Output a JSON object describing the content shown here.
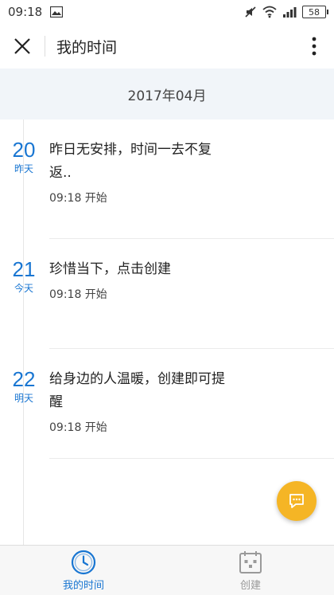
{
  "status_bar": {
    "time": "09:18",
    "battery": "58"
  },
  "title_bar": {
    "title": "我的时间"
  },
  "month_header": "2017年04月",
  "entries": [
    {
      "day": "20",
      "relative": "昨天",
      "title": "昨日无安排，时间一去不复返..",
      "start": "09:18 开始"
    },
    {
      "day": "21",
      "relative": "今天",
      "title": "珍惜当下，点击创建",
      "start": "09:18 开始"
    },
    {
      "day": "22",
      "relative": "明天",
      "title": "给身边的人温暖，创建即可提醒",
      "start": "09:18 开始"
    }
  ],
  "bottom_nav": {
    "my_time": "我的时间",
    "create": "创建"
  },
  "colors": {
    "accent": "#1976d2",
    "fab": "#f5b525",
    "month_bg": "#f1f5f9"
  }
}
